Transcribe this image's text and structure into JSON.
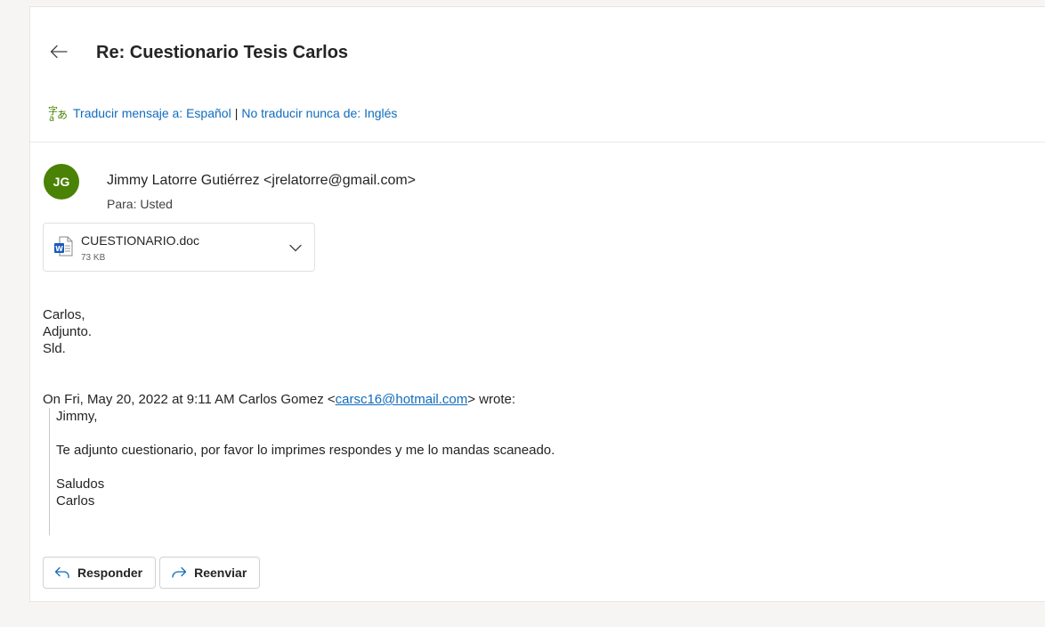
{
  "message": {
    "subject": "Re: Cuestionario Tesis Carlos",
    "translate": {
      "translate_link": "Traducir mensaje a: Español",
      "separator": "|",
      "never_link": "No traducir nunca de: Inglés"
    },
    "sender": {
      "initials": "JG",
      "avatar_color": "#498205",
      "display": "Jimmy Latorre Gutiérrez <jrelatorre@gmail.com>",
      "to": "Para:  Usted"
    },
    "attachment": {
      "name": "CUESTIONARIO.doc",
      "size": "73 KB",
      "icon": "word-doc-icon"
    },
    "body_lines": [
      "Carlos,",
      "Adjunto.",
      "Sld."
    ],
    "quote_header": {
      "prefix": "On Fri, May 20, 2022 at 9:11 AM Carlos Gomez <",
      "email": "carsc16@hotmail.com",
      "suffix": "> wrote:"
    },
    "quoted_lines": [
      "Jimmy,",
      "",
      "Te adjunto cuestionario, por favor lo imprimes respondes y me lo mandas scaneado.",
      "",
      "Saludos",
      "Carlos"
    ],
    "actions": {
      "reply_label": "Responder",
      "forward_label": "Reenviar"
    }
  },
  "colors": {
    "link": "#0f6cbd",
    "accent_icon": "#0f6cbd"
  }
}
